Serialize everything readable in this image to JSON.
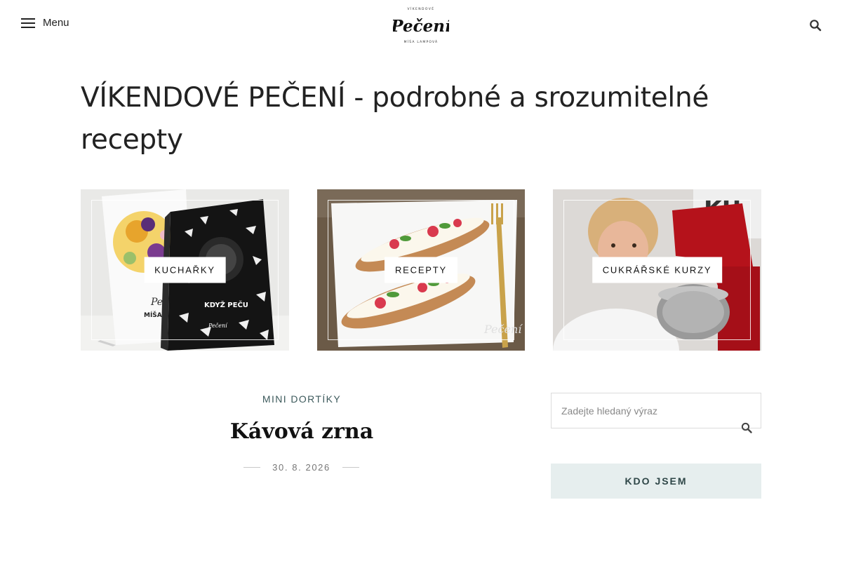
{
  "header": {
    "menu_label": "Menu",
    "logo_text": "Pečení",
    "logo_top_text": "VÍKENDOVÉ",
    "logo_bottom_text": "MÍŠA LAMPOVÁ",
    "search_icon": "search-icon"
  },
  "page": {
    "title": "VÍKENDOVÉ PEČENÍ - podrobné a srozumitelné recepty"
  },
  "tiles": [
    {
      "label": "KUCHAŘKY"
    },
    {
      "label": "RECEPTY"
    },
    {
      "label": "CUKRÁŘSKÉ KURZY"
    }
  ],
  "post": {
    "category": "MINI DORTÍKY",
    "title": "Kávová zrna",
    "date": "30. 8. 2026"
  },
  "sidebar": {
    "search_placeholder": "Zadejte hledaný výraz",
    "about_label": "KDO JSEM"
  },
  "colors": {
    "accent": "#3d5a5c",
    "about_bg": "#e6eeee"
  }
}
